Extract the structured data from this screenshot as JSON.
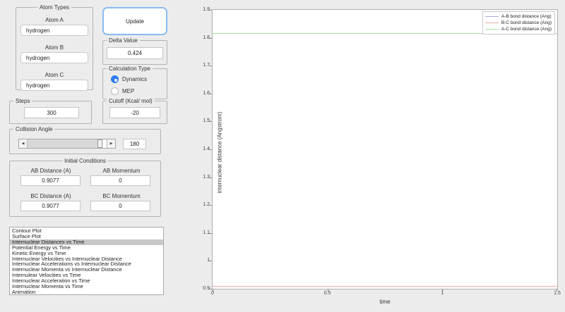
{
  "window": {
    "background": "#ececec",
    "accent_blue": "#3f9bf4",
    "radio_blue": "#2e7cf5",
    "selection_gray": "#c8c8c8"
  },
  "atom_types": {
    "title": "Atom Types",
    "atoms": [
      {
        "label": "Atom A",
        "value": "hydrogen"
      },
      {
        "label": "Atom B",
        "value": "hydrogen"
      },
      {
        "label": "Atom C",
        "value": "hydrogen"
      }
    ]
  },
  "update": {
    "label": "Update"
  },
  "delta": {
    "title": "Delta Value",
    "value": "0.424"
  },
  "calc_type": {
    "title": "Calculation Type",
    "options": [
      {
        "label": "Dynamics",
        "selected": true
      },
      {
        "label": "MEP",
        "selected": false
      }
    ]
  },
  "steps": {
    "title": "Steps",
    "value": "300"
  },
  "cutoff": {
    "title": "Cutoff (Kcal/ mol)",
    "value": "-20"
  },
  "collision": {
    "title": "Collision Angle",
    "value": "180",
    "slider_fraction": 0.89
  },
  "initial": {
    "title": "Initial Conditions",
    "fields": [
      {
        "label": "AB Distance (A)",
        "value": "0.9077"
      },
      {
        "label": "AB Momentum",
        "value": "0"
      },
      {
        "label": "BC Distance (A)",
        "value": "0.9077"
      },
      {
        "label": "BC Momentum",
        "value": "0"
      }
    ]
  },
  "plot_list": {
    "selected_index": 2,
    "items": [
      "Contour Plot",
      "Surface Plot",
      "Internuclear Distances vs Time",
      "Potential Energy vs Time",
      "Kinetic Energy vs Time",
      "Internuclear Velocities vs Internuclear Distance",
      "Internuclear Accelerations vs Internuclear Distance",
      "Internuclear Momenta vs Internuclear Distance",
      "Internulear Velocities vs Time",
      "Internuclear Acceleration vs Time",
      "Internuclear Momenta vs Time",
      "Animation"
    ]
  },
  "chart_data": {
    "type": "line",
    "title": "",
    "xlabel": "time",
    "ylabel": "internuclear distance (Angstrom)",
    "xlim": [
      0,
      1.5
    ],
    "ylim": [
      0.9,
      1.9
    ],
    "xticks": [
      0,
      0.5,
      1,
      1.5
    ],
    "xticklabels": [
      "0",
      "0.5",
      "1",
      "1.5"
    ],
    "yticks": [
      0.9,
      1,
      1.1,
      1.2,
      1.3,
      1.4,
      1.5,
      1.6,
      1.7,
      1.8,
      1.9
    ],
    "yticklabels": [
      "0.9",
      "1",
      "1.1",
      "1.2",
      "1.3",
      "1.4",
      "1.5",
      "1.6",
      "1.7",
      "1.8",
      "1.9"
    ],
    "grid": false,
    "legend_position": "top-right",
    "series": [
      {
        "name": "A-B bond distance (Ang)",
        "color": "#a9a9de",
        "y": 0.9077,
        "x_range": [
          0,
          1.5
        ]
      },
      {
        "name": "B-C bond distance (Ang)",
        "color": "#f0aba6",
        "y": 0.9077,
        "x_range": [
          0,
          1.5
        ]
      },
      {
        "name": "A-C bond distance (Ang)",
        "color": "#a9dda4",
        "y": 1.8154,
        "x_range": [
          0,
          1.5
        ]
      }
    ]
  }
}
